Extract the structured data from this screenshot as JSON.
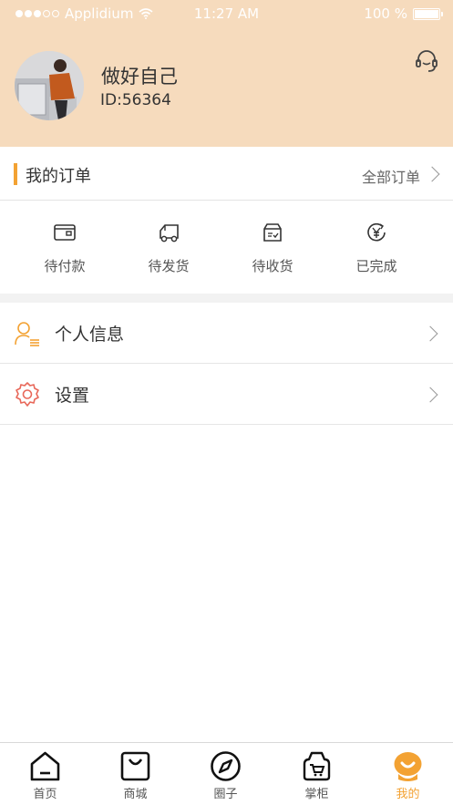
{
  "status_bar": {
    "carrier": "Applidium",
    "time": "11:27 AM",
    "battery": "100 %",
    "battery_level": 1.0
  },
  "profile": {
    "name": "做好自己",
    "id_text": "ID:56364",
    "service_icon": "headset-icon"
  },
  "orders": {
    "title": "我的订单",
    "all_label": "全部订单",
    "accent_color": "#f3a233",
    "items": [
      {
        "label": "待付款",
        "icon": "wallet-icon"
      },
      {
        "label": "待发货",
        "icon": "truck-icon"
      },
      {
        "label": "待收货",
        "icon": "inbox-icon"
      },
      {
        "label": "已完成",
        "icon": "yen-refresh-icon"
      }
    ]
  },
  "menu": [
    {
      "label": "个人信息",
      "icon": "user-info-icon"
    },
    {
      "label": "设置",
      "icon": "settings-icon"
    }
  ],
  "tabbar": {
    "items": [
      {
        "label": "首页",
        "icon": "home-icon"
      },
      {
        "label": "商城",
        "icon": "bag-icon"
      },
      {
        "label": "圈子",
        "icon": "compass-icon"
      },
      {
        "label": "掌柜",
        "icon": "cart-bag-icon"
      },
      {
        "label": "我的",
        "icon": "mine-icon"
      }
    ],
    "active": "我的",
    "active_color": "#f3a233"
  },
  "colors": {
    "header_bg": "#f6dbbd",
    "accent": "#f3a233",
    "settings_icon": "#e8685a"
  }
}
